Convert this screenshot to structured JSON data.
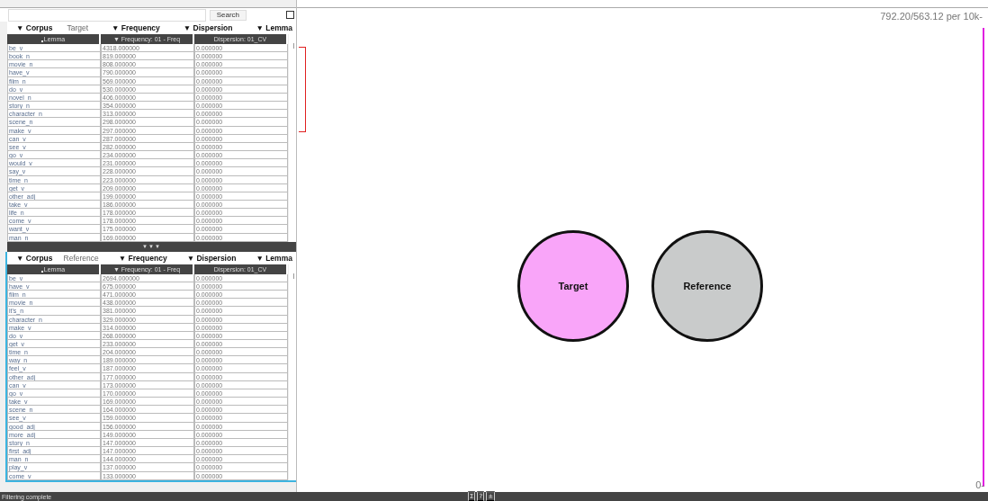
{
  "search": {
    "button": "Search"
  },
  "panels": [
    {
      "active": false,
      "filters": [
        {
          "label": "▼ Corpus",
          "value": "Target"
        },
        {
          "label": "▼ Frequency"
        },
        {
          "label": "▼ Dispersion"
        },
        {
          "label": "▼ Lemma"
        }
      ],
      "columns": [
        "Lemma",
        "▼ Frequency: 01 - Freq",
        "Dispersion: 01_CV"
      ],
      "rows": [
        [
          "be_v",
          "4318.000000",
          "0.000000"
        ],
        [
          "book_n",
          "819.000000",
          "0.000000"
        ],
        [
          "movie_n",
          "808.000000",
          "0.000000"
        ],
        [
          "have_v",
          "790.000000",
          "0.000000"
        ],
        [
          "film_n",
          "569.000000",
          "0.000000"
        ],
        [
          "do_v",
          "530.000000",
          "0.000000"
        ],
        [
          "novel_n",
          "406.000000",
          "0.000000"
        ],
        [
          "story_n",
          "354.000000",
          "0.000000"
        ],
        [
          "character_n",
          "313.000000",
          "0.000000"
        ],
        [
          "scene_n",
          "298.000000",
          "0.000000"
        ],
        [
          "make_v",
          "297.000000",
          "0.000000"
        ],
        [
          "can_v",
          "287.000000",
          "0.000000"
        ],
        [
          "see_v",
          "282.000000",
          "0.000000"
        ],
        [
          "go_v",
          "234.000000",
          "0.000000"
        ],
        [
          "would_v",
          "231.000000",
          "0.000000"
        ],
        [
          "say_v",
          "228.000000",
          "0.000000"
        ],
        [
          "time_n",
          "223.000000",
          "0.000000"
        ],
        [
          "get_v",
          "209.000000",
          "0.000000"
        ],
        [
          "other_adj",
          "199.000000",
          "0.000000"
        ],
        [
          "take_v",
          "186.000000",
          "0.000000"
        ],
        [
          "life_n",
          "178.000000",
          "0.000000"
        ],
        [
          "come_v",
          "178.000000",
          "0.000000"
        ],
        [
          "want_v",
          "175.000000",
          "0.000000"
        ],
        [
          "man_n",
          "169.000000",
          "0.000000"
        ]
      ]
    },
    {
      "active": true,
      "filters": [
        {
          "label": "▼ Corpus",
          "value": "Reference"
        },
        {
          "label": "▼ Frequency"
        },
        {
          "label": "▼ Dispersion"
        },
        {
          "label": "▼ Lemma"
        }
      ],
      "columns": [
        "Lemma",
        "▼ Frequency: 01 - Freq",
        "Dispersion: 01_CV"
      ],
      "rows": [
        [
          "be_v",
          "2694.000000",
          "0.000000"
        ],
        [
          "have_v",
          "675.000000",
          "0.000000"
        ],
        [
          "film_n",
          "471.000000",
          "0.000000"
        ],
        [
          "movie_n",
          "438.000000",
          "0.000000"
        ],
        [
          "it's_n",
          "381.000000",
          "0.000000"
        ],
        [
          "character_n",
          "329.000000",
          "0.000000"
        ],
        [
          "make_v",
          "314.000000",
          "0.000000"
        ],
        [
          "do_v",
          "268.000000",
          "0.000000"
        ],
        [
          "get_v",
          "233.000000",
          "0.000000"
        ],
        [
          "time_n",
          "204.000000",
          "0.000000"
        ],
        [
          "way_n",
          "189.000000",
          "0.000000"
        ],
        [
          "feel_v",
          "187.000000",
          "0.000000"
        ],
        [
          "other_adj",
          "177.000000",
          "0.000000"
        ],
        [
          "can_v",
          "173.000000",
          "0.000000"
        ],
        [
          "go_v",
          "170.000000",
          "0.000000"
        ],
        [
          "take_v",
          "169.000000",
          "0.000000"
        ],
        [
          "scene_n",
          "164.000000",
          "0.000000"
        ],
        [
          "see_v",
          "159.000000",
          "0.000000"
        ],
        [
          "good_adj",
          "156.000000",
          "0.000000"
        ],
        [
          "more_adj",
          "149.000000",
          "0.000000"
        ],
        [
          "story_n",
          "147.000000",
          "0.000000"
        ],
        [
          "first_adj",
          "147.000000",
          "0.000000"
        ],
        [
          "man_n",
          "144.000000",
          "0.000000"
        ],
        [
          "play_v",
          "137.000000",
          "0.000000"
        ],
        [
          "come_v",
          "133.000000",
          "0.000000"
        ]
      ]
    }
  ],
  "splitter": "▼▼▼",
  "chart": {
    "max_label": "792.20/563.12 per 10k-",
    "min_label": "0-",
    "circles": [
      {
        "label": "Target",
        "color": "#f9a5f9"
      },
      {
        "label": "Reference",
        "color": "#c9cbcb"
      }
    ]
  },
  "status_bar": {
    "message": "Filtering complete",
    "tools": [
      "Σ",
      "?",
      "±"
    ]
  }
}
